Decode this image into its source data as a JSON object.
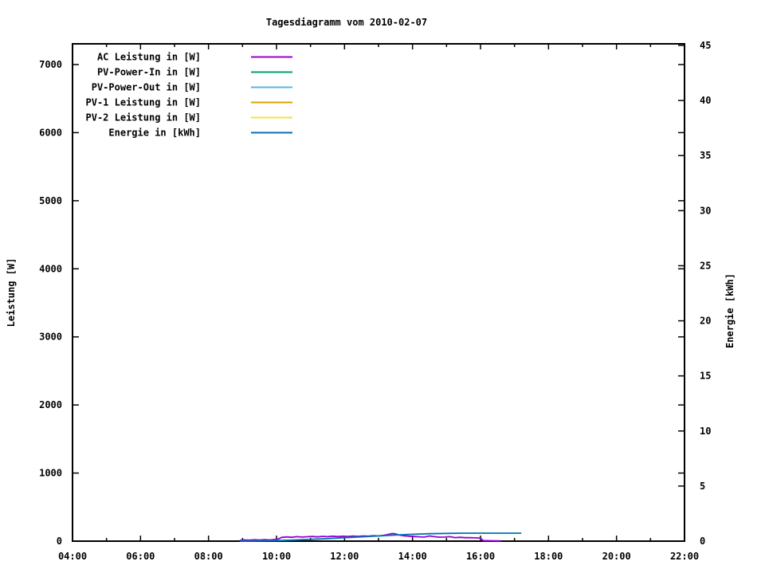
{
  "page": {
    "background": "#ffffff",
    "foreground": "#000000"
  },
  "chart_data": {
    "type": "line",
    "title": "Tagesdiagramm vom 2010-02-07",
    "xlabel": "",
    "ylabel": "Leistung [W]",
    "y2label": "Energie [kWh]",
    "grid": false,
    "legend_position": "top-left-inside",
    "x_axis": {
      "min_hour": 4,
      "max_hour": 22,
      "minor_step_hours": 1,
      "ticks": [
        {
          "h": 4,
          "label": "04:00"
        },
        {
          "h": 6,
          "label": "06:00"
        },
        {
          "h": 8,
          "label": "08:00"
        },
        {
          "h": 10,
          "label": "10:00"
        },
        {
          "h": 12,
          "label": "12:00"
        },
        {
          "h": 14,
          "label": "14:00"
        },
        {
          "h": 16,
          "label": "16:00"
        },
        {
          "h": 18,
          "label": "18:00"
        },
        {
          "h": 20,
          "label": "20:00"
        },
        {
          "h": 22,
          "label": "22:00"
        }
      ]
    },
    "y_axis": {
      "min": 0,
      "max": 7300,
      "tick_step": 1000,
      "tick_max": 7000,
      "tick_labels": [
        "0",
        "1000",
        "2000",
        "3000",
        "4000",
        "5000",
        "6000",
        "7000"
      ]
    },
    "y2_axis": {
      "min": 0,
      "max": 45.15,
      "tick_step": 5,
      "tick_max": 45,
      "tick_labels": [
        "0",
        "5",
        "10",
        "15",
        "20",
        "25",
        "30",
        "35",
        "40",
        "45"
      ]
    },
    "series": [
      {
        "name": "AC Leistung in [W]",
        "color": "#9400d3",
        "axis": "y1",
        "points": [
          [
            8.92,
            12
          ],
          [
            9.05,
            18
          ],
          [
            9.2,
            14
          ],
          [
            9.35,
            20
          ],
          [
            9.5,
            16
          ],
          [
            9.65,
            21
          ],
          [
            9.8,
            18
          ],
          [
            9.95,
            24
          ],
          [
            10.05,
            30
          ],
          [
            10.15,
            55
          ],
          [
            10.3,
            62
          ],
          [
            10.45,
            56
          ],
          [
            10.6,
            66
          ],
          [
            10.75,
            60
          ],
          [
            10.9,
            64
          ],
          [
            11.05,
            68
          ],
          [
            11.2,
            62
          ],
          [
            11.35,
            70
          ],
          [
            11.5,
            66
          ],
          [
            11.65,
            72
          ],
          [
            11.8,
            67
          ],
          [
            11.95,
            73
          ],
          [
            12.1,
            69
          ],
          [
            12.25,
            74
          ],
          [
            12.4,
            70
          ],
          [
            12.55,
            76
          ],
          [
            12.7,
            72
          ],
          [
            12.85,
            80
          ],
          [
            13.0,
            76
          ],
          [
            13.15,
            84
          ],
          [
            13.3,
            100
          ],
          [
            13.4,
            112
          ],
          [
            13.5,
            106
          ],
          [
            13.6,
            90
          ],
          [
            13.75,
            78
          ],
          [
            13.9,
            72
          ],
          [
            14.05,
            68
          ],
          [
            14.2,
            63
          ],
          [
            14.35,
            60
          ],
          [
            14.5,
            76
          ],
          [
            14.65,
            64
          ],
          [
            14.8,
            58
          ],
          [
            14.95,
            60
          ],
          [
            15.1,
            66
          ],
          [
            15.25,
            52
          ],
          [
            15.4,
            56
          ],
          [
            15.55,
            50
          ],
          [
            15.7,
            52
          ],
          [
            15.85,
            48
          ],
          [
            16.0,
            44
          ],
          [
            16.08,
            8
          ],
          [
            16.3,
            6
          ],
          [
            16.6,
            5
          ]
        ]
      },
      {
        "name": "PV-Power-In in [W]",
        "color": "#009e73",
        "axis": "y1",
        "points": []
      },
      {
        "name": "PV-Power-Out in [W]",
        "color": "#56b4e9",
        "axis": "y1",
        "points": []
      },
      {
        "name": "PV-1 Leistung in [W]",
        "color": "#e69f00",
        "axis": "y1",
        "points": []
      },
      {
        "name": "PV-2 Leistung in [W]",
        "color": "#f0e442",
        "axis": "y1",
        "points": []
      },
      {
        "name": "Energie in [kWh]",
        "color": "#0072b2",
        "axis": "y2",
        "points": [
          [
            8.92,
            0
          ],
          [
            9.5,
            0.02
          ],
          [
            10.0,
            0.05
          ],
          [
            10.5,
            0.1
          ],
          [
            11.0,
            0.16
          ],
          [
            11.5,
            0.23
          ],
          [
            12.0,
            0.31
          ],
          [
            12.5,
            0.39
          ],
          [
            13.0,
            0.47
          ],
          [
            13.5,
            0.56
          ],
          [
            14.0,
            0.62
          ],
          [
            14.5,
            0.67
          ],
          [
            15.0,
            0.7
          ],
          [
            15.5,
            0.72
          ],
          [
            16.0,
            0.72
          ],
          [
            16.6,
            0.72
          ],
          [
            17.2,
            0.72
          ]
        ]
      }
    ]
  }
}
